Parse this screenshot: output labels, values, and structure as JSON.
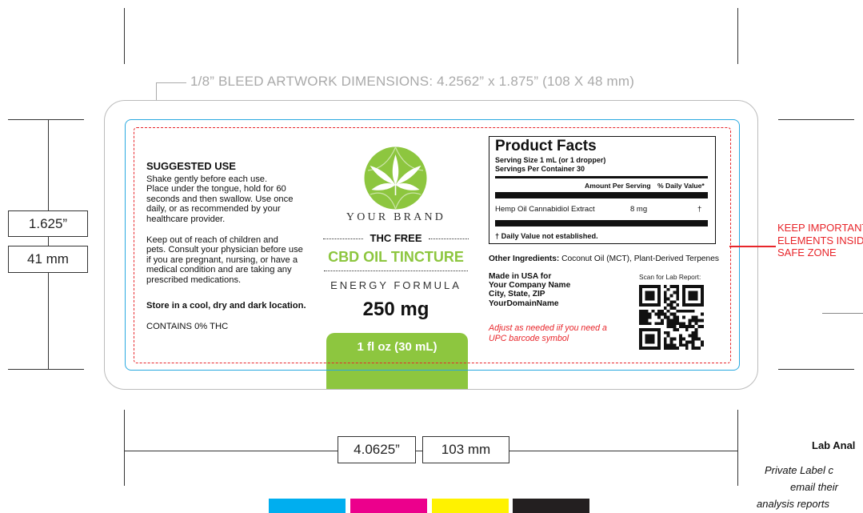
{
  "dieline": {
    "bleed_caption": "1/8” BLEED ARTWORK DIMENSIONS:  4.2562” x 1.875” (108 X 48 mm)",
    "height_in": "1.625”",
    "height_mm": "41 mm",
    "width_in": "4.0625”",
    "width_mm": "103 mm",
    "trim_color": "#29a9e0",
    "safe_zone_color": "#e8262b",
    "safe_zone_note": [
      "KEEP IMPORTANT",
      "ELEMENTS INSIDE",
      "SAFE ZONE"
    ]
  },
  "suggested_use": {
    "title": "SUGGESTED USE",
    "lines": [
      "Shake gently before each use.",
      "Place under the tongue, hold for 60",
      "seconds and then swallow. Use once",
      "daily, or as recommended by your",
      "healthcare provider."
    ],
    "warning_lines": [
      "Keep out of reach of children and",
      "pets. Consult your physician before use",
      "if you are pregnant, nursing, or have a",
      "medical condition and are taking any",
      "prescribed medications."
    ],
    "storage": "Store in a cool, dry and dark location.",
    "thc_note": "CONTAINS 0% THC"
  },
  "center_panel": {
    "brand": "YOUR BRAND",
    "thc_free": "THC FREE",
    "product_name": "CBD OIL TINCTURE",
    "formula": "ENERGY FORMULA",
    "strength": "250 mg",
    "volume": "1 fl oz (30 mL)",
    "accent_color": "#8dc63f"
  },
  "product_facts": {
    "title": "Product Facts",
    "serving_size": "Serving Size 1 mL (or 1 dropper)",
    "servings_per_container": "Servings Per Container 30",
    "amount_header": "Amount Per Serving",
    "dv_header": "% Daily Value*",
    "row": {
      "name": "Hemp Oil Cannabidiol Extract",
      "amount": "8 mg",
      "dv": "†"
    },
    "footnote": "†  Daily Value not established."
  },
  "ingredients": {
    "label": "Other Ingredients:",
    "text": " Coconut Oil (MCT), Plant-Derived Terpenes"
  },
  "manufacturer": [
    "Made in USA for",
    "Your Company Name",
    "City, State, ZIP",
    "YourDomainName"
  ],
  "upc_note": [
    "Adjust as needed iif you need a",
    "UPC barcode symbol"
  ],
  "lab": {
    "scan_label": "Scan for Lab Report:",
    "title": "Lab Anal",
    "lines": [
      "Private Label c",
      "email their",
      "analysis reports"
    ]
  },
  "swatches": [
    "#00aeef",
    "#ec008c",
    "#fff200",
    "#231f20"
  ]
}
